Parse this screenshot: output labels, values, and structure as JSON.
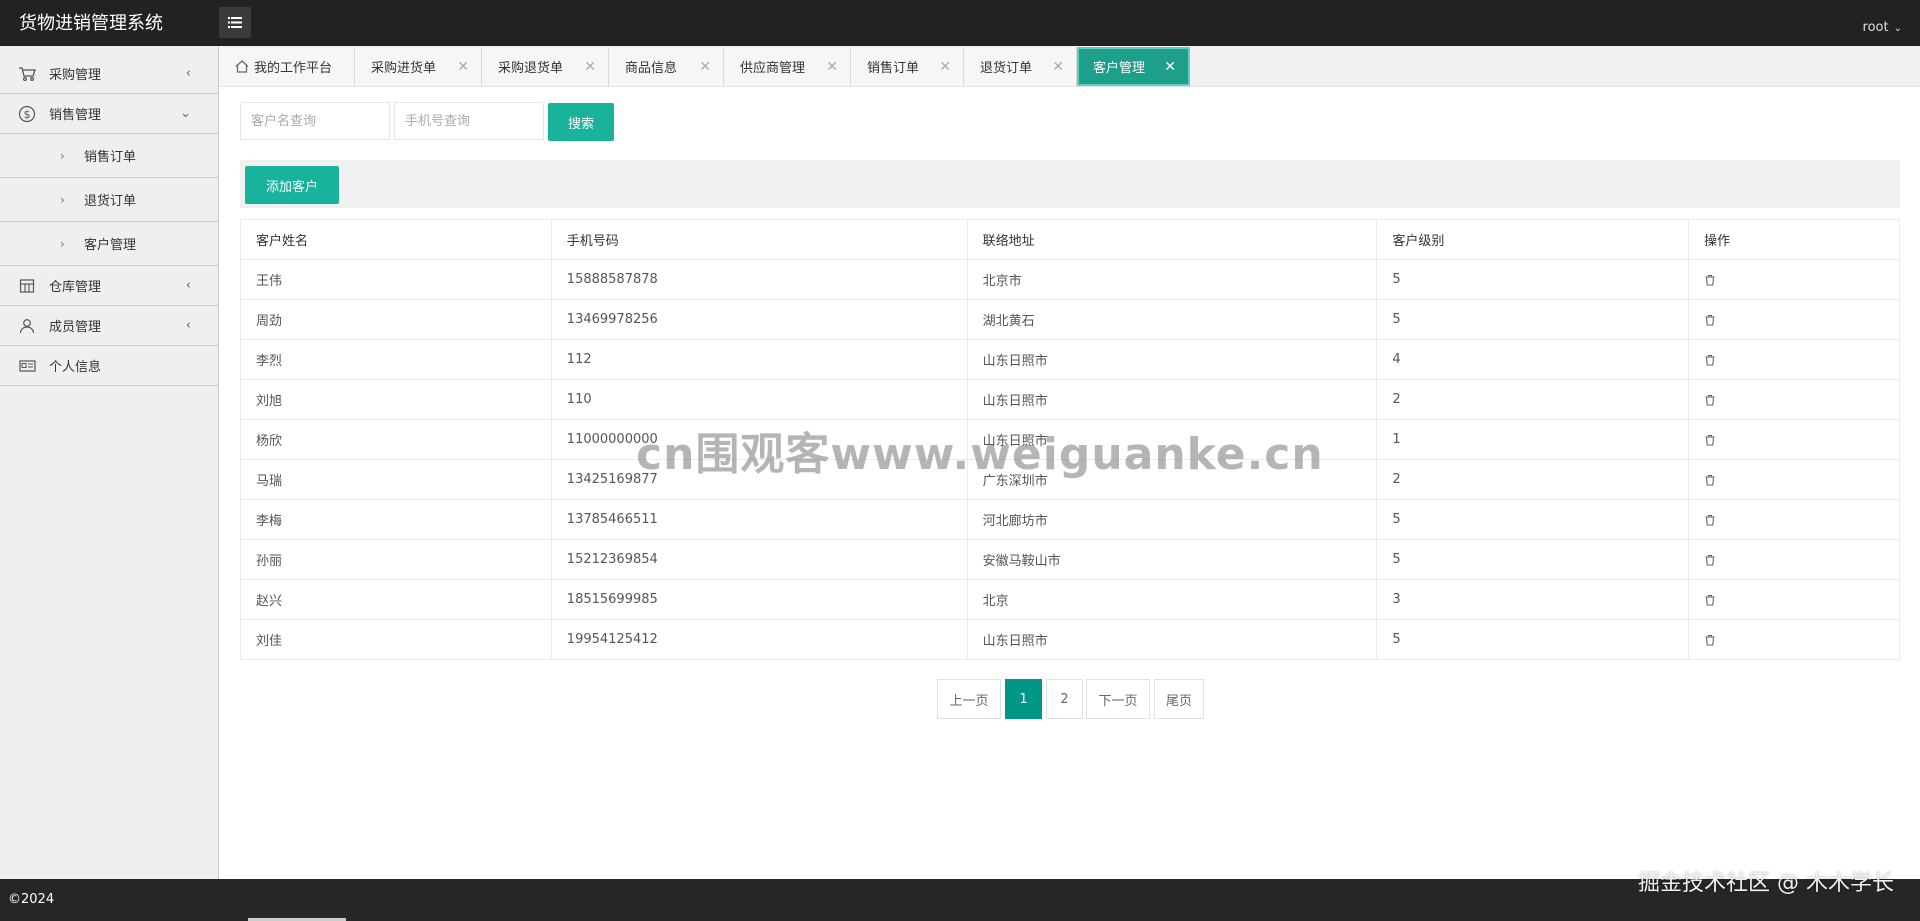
{
  "app": {
    "title": "货物进销管理系统",
    "user": "root"
  },
  "sidebar": {
    "items": [
      {
        "label": "采购管理",
        "icon": "cart-icon",
        "arrow": "‹"
      },
      {
        "label": "销售管理",
        "icon": "dollar-icon",
        "arrow": "⌄"
      },
      {
        "label": "仓库管理",
        "icon": "warehouse-icon",
        "arrow": "‹"
      },
      {
        "label": "成员管理",
        "icon": "user-icon",
        "arrow": "‹"
      },
      {
        "label": "个人信息",
        "icon": "id-card-icon",
        "arrow": ""
      }
    ],
    "sub_items": [
      {
        "label": "销售订单"
      },
      {
        "label": "退货订单"
      },
      {
        "label": "客户管理"
      }
    ]
  },
  "tabs": [
    {
      "label": "我的工作平台",
      "icon": "home-icon"
    },
    {
      "label": "采购进货单",
      "close": "✕"
    },
    {
      "label": "采购退货单",
      "close": "✕"
    },
    {
      "label": "商品信息",
      "close": "✕"
    },
    {
      "label": "供应商管理",
      "close": "✕"
    },
    {
      "label": "销售订单",
      "close": "✕"
    },
    {
      "label": "退货订单",
      "close": "✕"
    },
    {
      "label": "客户管理",
      "close": "✕",
      "active": true
    }
  ],
  "search": {
    "name_placeholder": "客户名查询",
    "phone_placeholder": "手机号查询",
    "button": "搜索"
  },
  "toolbar": {
    "add_button": "添加客户"
  },
  "table": {
    "columns": [
      "客户姓名",
      "手机号码",
      "联络地址",
      "客户级别",
      "操作"
    ],
    "rows": [
      [
        "王伟",
        "15888587878",
        "北京市",
        "5"
      ],
      [
        "周劲",
        "13469978256",
        "湖北黄石",
        "5"
      ],
      [
        "李烈",
        "112",
        "山东日照市",
        "4"
      ],
      [
        "刘旭",
        "110",
        "山东日照市",
        "2"
      ],
      [
        "杨欣",
        "11000000000",
        "山东日照市",
        "1"
      ],
      [
        "马瑞",
        "13425169877",
        "广东深圳市",
        "2"
      ],
      [
        "李梅",
        "13785466511",
        "河北廊坊市",
        "5"
      ],
      [
        "孙丽",
        "15212369854",
        "安徽马鞍山市",
        "5"
      ],
      [
        "赵兴",
        "18515699985",
        "北京",
        "3"
      ],
      [
        "刘佳",
        "19954125412",
        "山东日照市",
        "5"
      ]
    ],
    "action_icon": "trash-icon"
  },
  "pagination": {
    "prev": "上一页",
    "pages": [
      "1",
      "2"
    ],
    "current": "1",
    "next": "下一页",
    "last": "尾页"
  },
  "footer": {
    "copyright": "©2024",
    "credit": "掘金技术社区 @ 木木学长"
  },
  "watermark": "cn围观客www.weiguanke.cn",
  "colors": {
    "accent": "#19b39c",
    "active_tab": "#1e9f89",
    "header": "#222222",
    "pager_current": "#009688"
  }
}
